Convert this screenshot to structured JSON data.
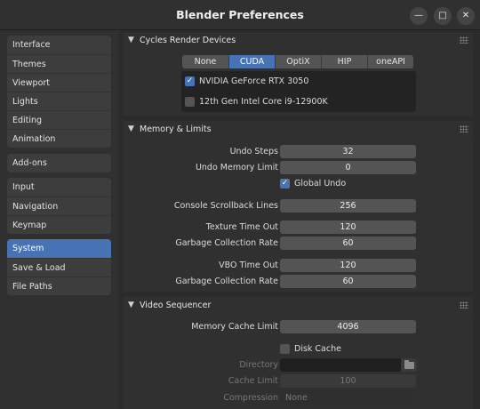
{
  "window": {
    "title": "Blender Preferences",
    "min_glyph": "—",
    "max_glyph": "□",
    "close_glyph": "✕"
  },
  "sidebar": {
    "groups": [
      [
        "Interface",
        "Themes",
        "Viewport",
        "Lights",
        "Editing",
        "Animation"
      ],
      [
        "Add-ons"
      ],
      [
        "Input",
        "Navigation",
        "Keymap"
      ],
      [
        "System",
        "Save & Load",
        "File Paths"
      ]
    ],
    "active": "System",
    "menu_glyph": "☰"
  },
  "cycles": {
    "title": "Cycles Render Devices",
    "backends": [
      "None",
      "CUDA",
      "OptiX",
      "HIP",
      "oneAPI"
    ],
    "selected_backend": "CUDA",
    "devices": [
      {
        "name": "NVIDIA GeForce RTX 3050",
        "checked": true
      },
      {
        "name": "12th Gen Intel Core i9-12900K",
        "checked": false
      }
    ]
  },
  "memory": {
    "title": "Memory & Limits",
    "undo_steps": {
      "label": "Undo Steps",
      "value": "32"
    },
    "undo_memory_limit": {
      "label": "Undo Memory Limit",
      "value": "0"
    },
    "global_undo": {
      "label": "Global Undo",
      "checked": true
    },
    "console_scrollback": {
      "label": "Console Scrollback Lines",
      "value": "256"
    },
    "texture_timeout": {
      "label": "Texture Time Out",
      "value": "120"
    },
    "texture_gc_rate": {
      "label": "Garbage Collection Rate",
      "value": "60"
    },
    "vbo_timeout": {
      "label": "VBO Time Out",
      "value": "120"
    },
    "vbo_gc_rate": {
      "label": "Garbage Collection Rate",
      "value": "60"
    }
  },
  "sequencer": {
    "title": "Video Sequencer",
    "memory_cache_limit": {
      "label": "Memory Cache Limit",
      "value": "4096"
    },
    "disk_cache": {
      "label": "Disk Cache",
      "checked": false
    },
    "directory": {
      "label": "Directory",
      "value": ""
    },
    "cache_limit": {
      "label": "Cache Limit",
      "value": "100"
    },
    "compression": {
      "label": "Compression",
      "value": "None"
    }
  },
  "colors": {
    "accent": "#4772b3",
    "panel": "#303030",
    "field": "#545454",
    "background": "#2b2b2b"
  },
  "icons": {
    "panel_open": "chevron-down-icon",
    "drag": "grip-icon",
    "folder": "folder-icon",
    "check": "checkmark-icon"
  }
}
